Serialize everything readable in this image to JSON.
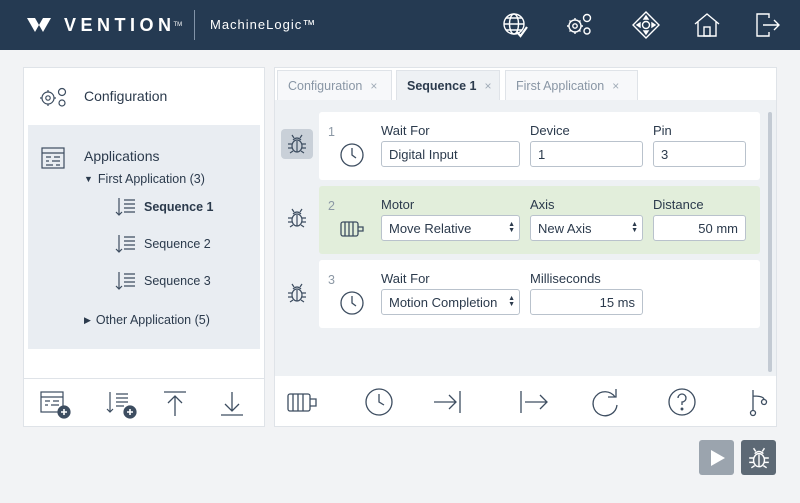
{
  "header": {
    "brand": "VENTION",
    "app_name": "MachineLogic™",
    "icons": [
      "network-check-icon",
      "gears-icon",
      "jog-control-icon",
      "home-icon",
      "logout-icon"
    ]
  },
  "sidebar": {
    "configuration_label": "Configuration",
    "applications_label": "Applications",
    "tree": {
      "first_app": "First Application (3)",
      "sequences": [
        "Sequence 1",
        "Sequence 2",
        "Sequence 3"
      ],
      "active_sequence": "Sequence 1",
      "other_app": "Other Application (5)"
    },
    "toolbar_icons": [
      "add-application-icon",
      "add-sequence-icon",
      "upload-icon",
      "download-icon"
    ]
  },
  "editor": {
    "tabs": [
      {
        "label": "Configuration",
        "active": false
      },
      {
        "label": "Sequence 1",
        "active": true
      },
      {
        "label": "First Application",
        "active": false
      }
    ],
    "close_glyph": "×",
    "steps": [
      {
        "number": "1",
        "type": "wait",
        "fields": [
          {
            "label": "Wait For",
            "value": "Digital Input"
          },
          {
            "label": "Device",
            "value": "1"
          },
          {
            "label": "Pin",
            "value": "3"
          }
        ]
      },
      {
        "number": "2",
        "type": "motor",
        "fields": [
          {
            "label": "Motor",
            "value": "Move Relative"
          },
          {
            "label": "Axis",
            "value": "New Axis"
          },
          {
            "label": "Distance",
            "value": "50 mm"
          }
        ]
      },
      {
        "number": "3",
        "type": "wait",
        "fields": [
          {
            "label": "Wait For",
            "value": "Motion Completion"
          },
          {
            "label": "Milliseconds",
            "value": "15 ms"
          }
        ]
      }
    ],
    "toolbar_icons": [
      "motor-icon",
      "wait-icon",
      "end-icon",
      "next-icon",
      "loop-icon",
      "help-icon",
      "branch-icon"
    ]
  },
  "colors": {
    "header_bg": "#253a52",
    "motor_card_bg": "#e2eedb",
    "run_button": "#9ba4ae",
    "debug_button": "#5d6975"
  }
}
